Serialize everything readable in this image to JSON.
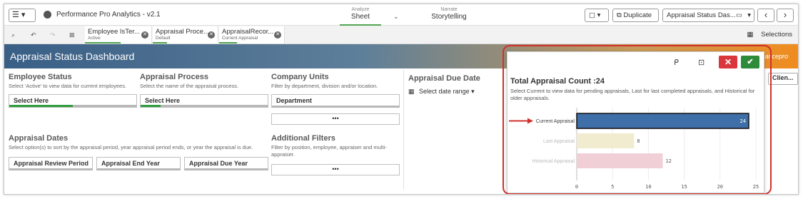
{
  "app": {
    "menu_label": "☰ ▾",
    "title": "Performance Pro Analytics - v2.1"
  },
  "nav": {
    "analyze_small": "Analyze",
    "analyze_big": "Sheet",
    "narrate_small": "Narrate",
    "narrate_big": "Storytelling"
  },
  "toolbar": {
    "bookmark_label": "▾",
    "duplicate_label": "Duplicate",
    "sheet_select": "Appraisal Status Das...",
    "sheet_select_caret": "▾",
    "prev": "‹",
    "next": "›"
  },
  "selections": {
    "chips": [
      {
        "name": "Employee IsTer...",
        "value": "Active"
      },
      {
        "name": "Appraisal Proce...",
        "value": "Default"
      },
      {
        "name": "AppraisalRecor...",
        "value": "Current Appraisal"
      }
    ],
    "right_label": "Selections"
  },
  "header": {
    "title": "Appraisal Status Dashboard",
    "logo_text": "ancepro"
  },
  "filters": {
    "employee_status": {
      "title": "Employee Status",
      "desc": "Select 'Active' to view data for current employees.",
      "box": "Select Here"
    },
    "appraisal_process": {
      "title": "Appraisal Process",
      "desc": "Select the name of the appraisal process.",
      "box": "Select Here"
    },
    "company_units": {
      "title": "Company Units",
      "desc": "Filter by department, division and/or location.",
      "box": "Department",
      "more": "•••"
    },
    "appraisal_dates": {
      "title": "Appraisal Dates",
      "desc": "Select option(s) to sort by the appraisal period, year appraisal period ends, or year the appraisal is due.",
      "boxes": [
        "Appraisal Review Period",
        "Appraisal End Year",
        "Appraisal Due Year"
      ]
    },
    "additional": {
      "title": "Additional Filters",
      "desc": "Filter by position, employee, appraiser and multi-appraiser.",
      "more": "•••"
    },
    "due_date": {
      "title": "Appraisal Due Date",
      "range": "Select date range ▾"
    },
    "clien_button": "Clien..."
  },
  "popup": {
    "title": "Total Appraisal Count :24",
    "subtitle": "Select Current to view data for pending appraisals, Last for last completed appraisals, and Historical for older appraisals.",
    "icons": [
      "lasso-icon",
      "clear-selection-icon"
    ],
    "cancel": "✕",
    "confirm": "✔"
  },
  "colors": {
    "current": "#3e6fa8",
    "last": "#f1ebd0",
    "historical": "#f1cfd6",
    "highlight": "#d0312d"
  },
  "chart_data": {
    "type": "bar",
    "orientation": "horizontal",
    "categories": [
      "Current Appraisal",
      "Last Appraisal",
      "Historical Appraisal"
    ],
    "values": [
      24,
      8,
      12
    ],
    "xlim": [
      0,
      25
    ],
    "xticks": [
      "0",
      "5",
      "10",
      "15",
      "20",
      "25"
    ],
    "grid": true
  }
}
